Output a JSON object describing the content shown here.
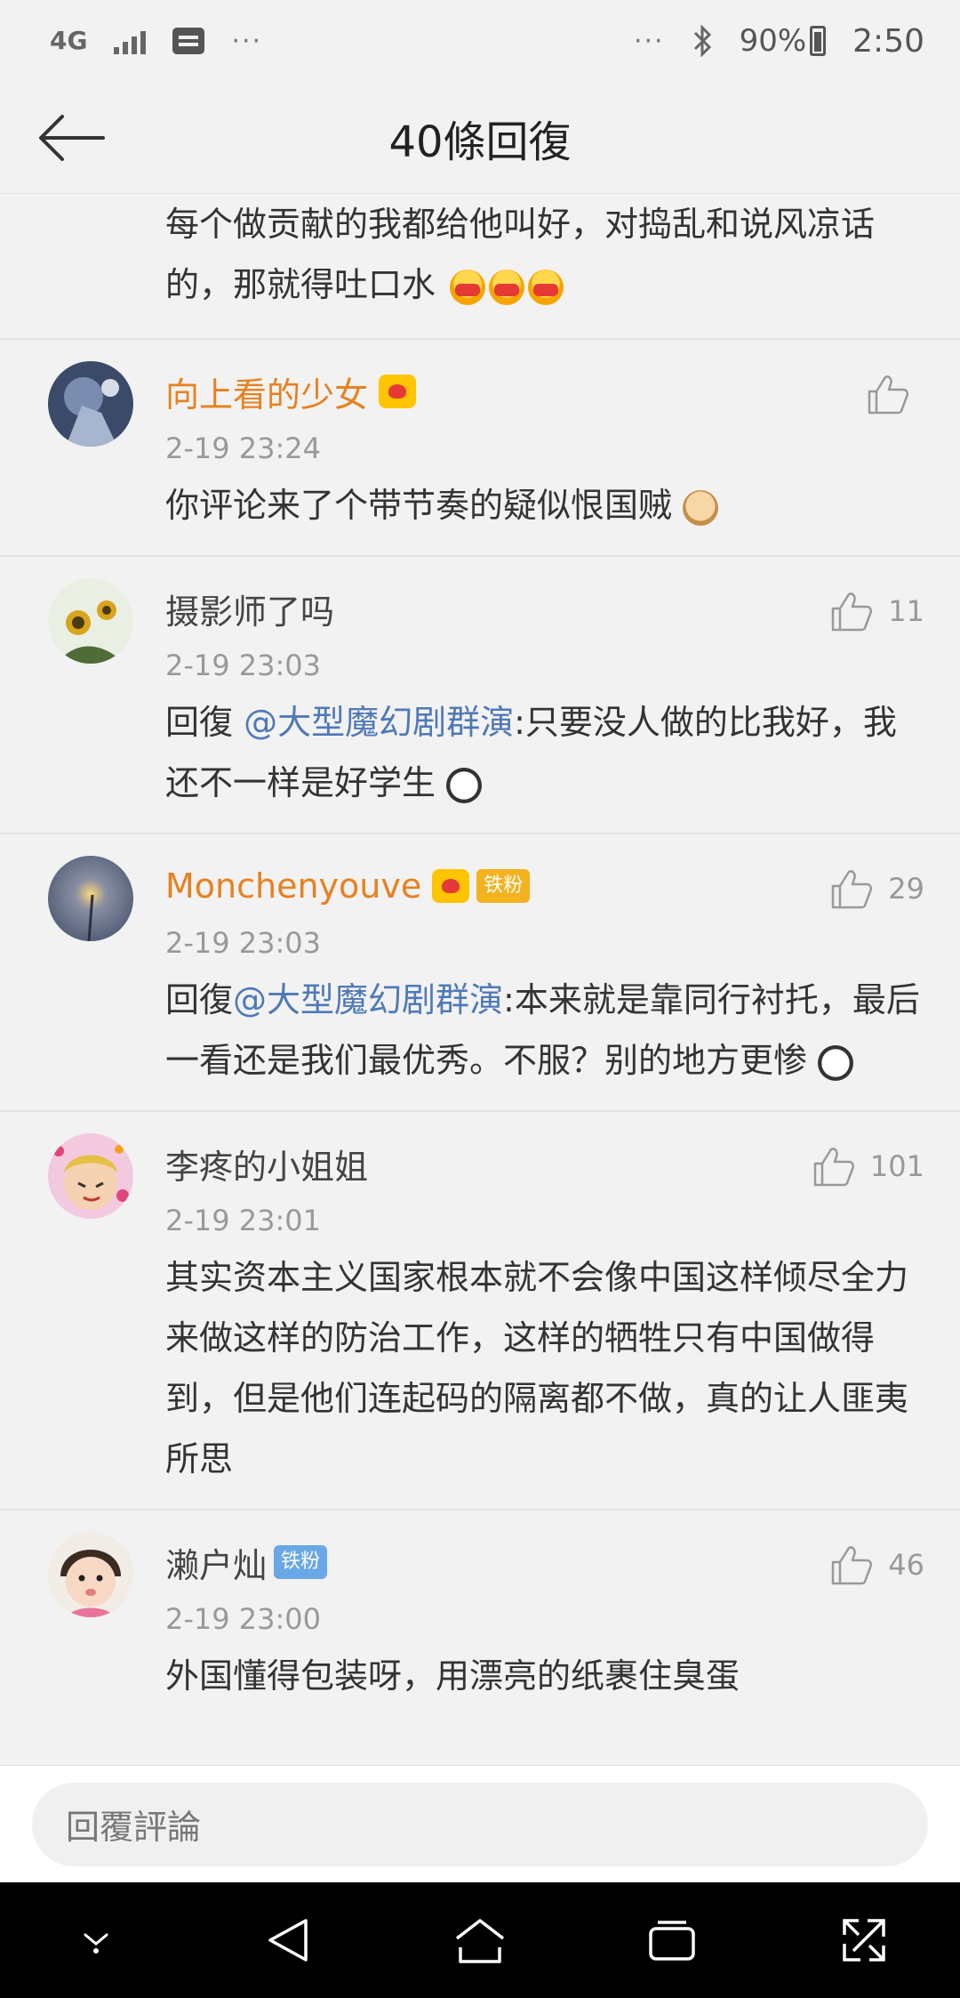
{
  "status_bar": {
    "network": "4G",
    "battery": "90%",
    "time": "2:50",
    "dots_left": "···",
    "dots_right": "···"
  },
  "header": {
    "title": "40條回復"
  },
  "partial_comment": {
    "text": "每个做贡献的我都给他叫好，对捣乱和说风凉话的，那就得吐口水"
  },
  "comments": [
    {
      "username": "向上看的少女",
      "time": "2-19 23:24",
      "likes": "",
      "text": "你评论来了个带节奏的疑似恨国贼"
    },
    {
      "username": "摄影师了吗",
      "time": "2-19 23:03",
      "likes": "11",
      "reply_prefix": "回復 ",
      "mention": "@大型魔幻剧群演",
      "text": ":只要没人做的比我好，我还不一样是好学生"
    },
    {
      "username": "Monchenyouve",
      "badge": "铁粉",
      "time": "2-19 23:03",
      "likes": "29",
      "reply_prefix": "回復",
      "mention": "@大型魔幻剧群演",
      "text": ":本来就是靠同行衬托，最后一看还是我们最优秀。不服？别的地方更惨"
    },
    {
      "username": "李疼的小姐姐",
      "time": "2-19 23:01",
      "likes": "101",
      "text": "其实资本主义国家根本就不会像中国这样倾尽全力来做这样的防治工作，这样的牺牲只有中国做得到，但是他们连起码的隔离都不做，真的让人匪夷所思"
    },
    {
      "username": "濑户灿",
      "badge": "铁粉",
      "time": "2-19 23:00",
      "likes": "46",
      "text": "外国懂得包装呀，用漂亮的纸裹住臭蛋"
    }
  ],
  "reply_bar": {
    "placeholder": "回覆評論"
  }
}
